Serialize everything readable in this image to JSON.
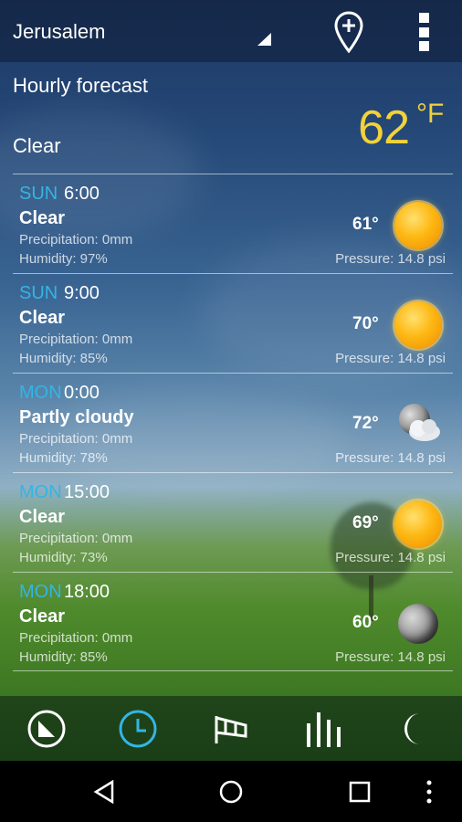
{
  "header": {
    "city": "Jerusalem",
    "add_location_icon": "location-pin-plus-icon",
    "menu_icon": "overflow-menu-icon"
  },
  "current": {
    "section_title": "Hourly forecast",
    "condition": "Clear",
    "temperature": "62",
    "unit": "°F"
  },
  "forecast": [
    {
      "day": "SUN",
      "time": "6:00",
      "condition": "Clear",
      "precipitation": "Precipitation: 0mm",
      "humidity": "Humidity: 97%",
      "temperature": "61°",
      "pressure": "Pressure: 14.8 psi",
      "icon": "sun-icon"
    },
    {
      "day": "SUN",
      "time": "9:00",
      "condition": "Clear",
      "precipitation": "Precipitation: 0mm",
      "humidity": "Humidity: 85%",
      "temperature": "70°",
      "pressure": "Pressure: 14.8 psi",
      "icon": "sun-icon"
    },
    {
      "day": "MON",
      "time": "0:00",
      "condition": "Partly cloudy",
      "precipitation": "Precipitation: 0mm",
      "humidity": "Humidity: 78%",
      "temperature": "72°",
      "pressure": "Pressure: 14.8 psi",
      "icon": "moon-cloud-icon"
    },
    {
      "day": "MON",
      "time": "15:00",
      "condition": "Clear",
      "precipitation": "Precipitation: 0mm",
      "humidity": "Humidity: 73%",
      "temperature": "69°",
      "pressure": "Pressure: 14.8 psi",
      "icon": "sun-icon"
    },
    {
      "day": "MON",
      "time": "18:00",
      "condition": "Clear",
      "precipitation": "Precipitation: 0mm",
      "humidity": "Humidity: 85%",
      "temperature": "60°",
      "pressure": "Pressure: 14.8 psi",
      "icon": "moon-icon"
    }
  ],
  "tabs": [
    {
      "icon": "current-weather-icon",
      "active": false
    },
    {
      "icon": "hourly-clock-icon",
      "active": true
    },
    {
      "icon": "wind-sock-icon",
      "active": false
    },
    {
      "icon": "bar-graph-icon",
      "active": false
    },
    {
      "icon": "moon-phase-icon",
      "active": false
    }
  ],
  "colors": {
    "accent": "#33b5e5",
    "temperature": "#f2d23a"
  },
  "navbar": [
    "back-icon",
    "home-icon",
    "recents-icon",
    "overflow-icon"
  ]
}
